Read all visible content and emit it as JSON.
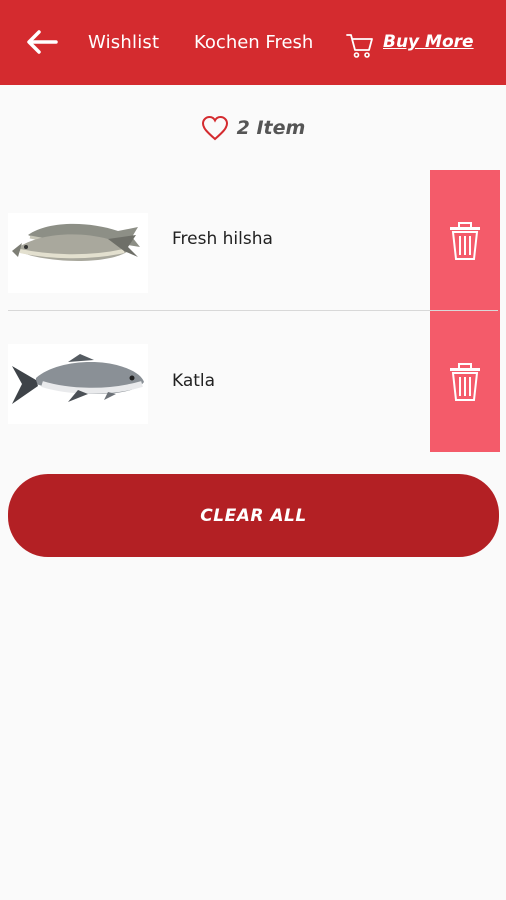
{
  "header": {
    "back_icon": "arrow-left-icon",
    "wishlist_label": "Wishlist",
    "brand_label": "Kochen Fresh",
    "cart_icon": "cart-icon",
    "buy_more_label": "Buy More",
    "bg_color": "#d42b2f"
  },
  "summary": {
    "heart_icon": "heart-icon",
    "count_text": "2 Item"
  },
  "items": [
    {
      "name": "Fresh hilsha",
      "image": "hilsha-fish",
      "delete_icon": "trash-icon"
    },
    {
      "name": "Katla",
      "image": "katla-fish",
      "delete_icon": "trash-icon"
    }
  ],
  "actions": {
    "clear_all_label": "CLEAR ALL",
    "clear_color": "#b32024",
    "delete_color": "#f45b6a"
  }
}
